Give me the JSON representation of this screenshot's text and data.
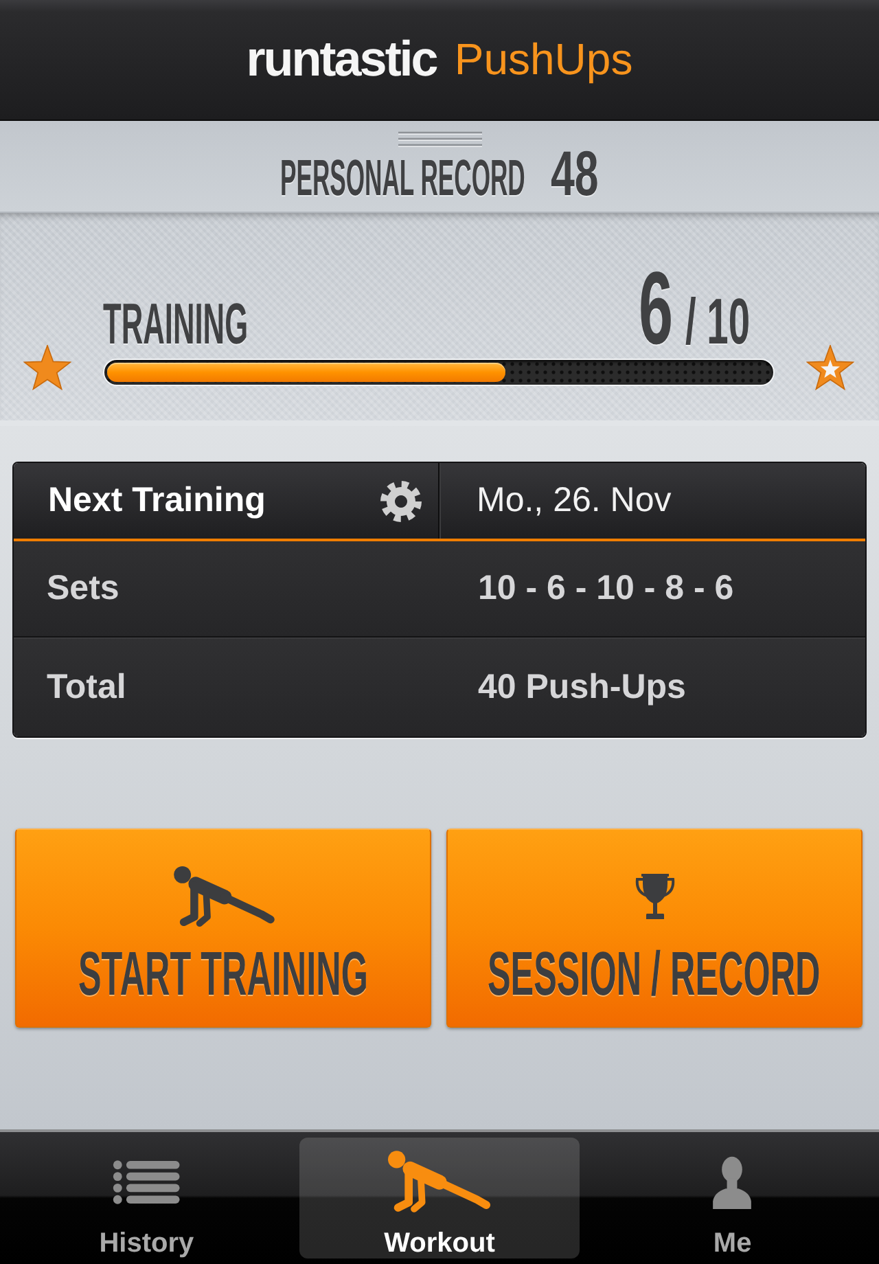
{
  "header": {
    "brand": "runtastic",
    "app_name": "PushUps"
  },
  "personal_record": {
    "label": "PERSONAL RECORD",
    "value": "48"
  },
  "training": {
    "label": "TRAINING",
    "current": "6",
    "total": "/ 10",
    "level": 0.6
  },
  "next_training": {
    "label": "Next Training",
    "date": "Mo., 26. Nov",
    "rows": [
      {
        "label": "Sets",
        "value": "10 - 6 - 10 - 8 - 6"
      },
      {
        "label": "Total",
        "value": "40 Push-Ups"
      }
    ]
  },
  "actions": [
    {
      "kind": "pushup",
      "label": "START TRAINING"
    },
    {
      "kind": "trophy",
      "label": "SESSION / RECORD"
    }
  ],
  "tab_bar": {
    "tabs": [
      {
        "kind": "list",
        "label": "History",
        "selected": false
      },
      {
        "kind": "pushup",
        "label": "Workout",
        "selected": true
      },
      {
        "kind": "person",
        "label": "Me",
        "selected": false
      }
    ]
  }
}
